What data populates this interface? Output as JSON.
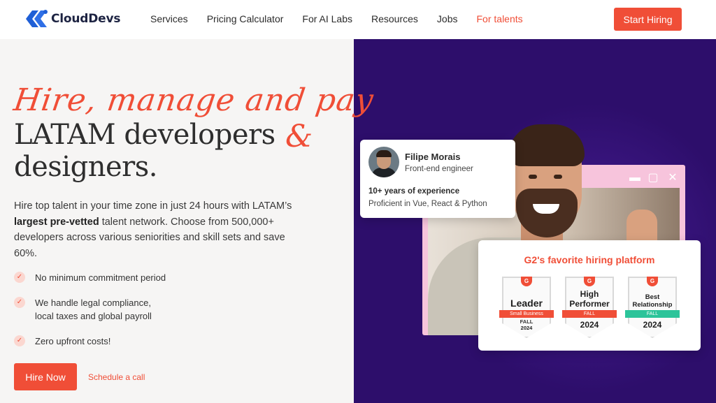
{
  "header": {
    "logo_text": "CloudDevs",
    "nav": {
      "services": "Services",
      "pricing": "Pricing Calculator",
      "ai_labs": "For AI Labs",
      "resources": "Resources",
      "jobs": "Jobs",
      "talents": "For talents"
    },
    "cta": "Start Hiring"
  },
  "hero": {
    "script_line": "Hire, manage and pay",
    "heading_line1": "LATAM developers",
    "ampersand": "&",
    "heading_line2": "designers.",
    "desc_part1": "Hire top talent in your time zone in just 24 hours with LATAM’s ",
    "desc_bold": "largest pre-vetted",
    "desc_part2": " talent network. Choose from 500,000+ developers across various seniorities and skill sets and save 60%.",
    "checklist": [
      "No minimum commitment period",
      "We handle legal compliance,",
      "local taxes and global payroll",
      "Zero upfront costs!"
    ],
    "primary_button": "Hire Now",
    "secondary_link": "Schedule a call"
  },
  "profile_card": {
    "name": "Filipe Morais",
    "role": "Front-end engineer",
    "experience": "10+ years of experience",
    "skills": "Proficient in Vue, React & Python"
  },
  "g2_card": {
    "title": "G2's favorite hiring platform",
    "badges": [
      {
        "logo": "G",
        "title": "Leader",
        "ribbon": "Small Business",
        "season": "FALL",
        "year": "2024"
      },
      {
        "logo": "G",
        "title_line1": "High",
        "title_line2": "Performer",
        "ribbon": "FALL",
        "year": "2024"
      },
      {
        "logo": "G",
        "title_line1": "Best",
        "title_line2": "Relationship",
        "ribbon": "FALL",
        "year": "2024"
      }
    ]
  },
  "window_controls": {
    "minimize": "▬",
    "maximize": "▢",
    "close": "✕"
  },
  "colors": {
    "accent": "#f04e37",
    "panel": "#2d0e6b",
    "frame": "#f7c4dc"
  }
}
